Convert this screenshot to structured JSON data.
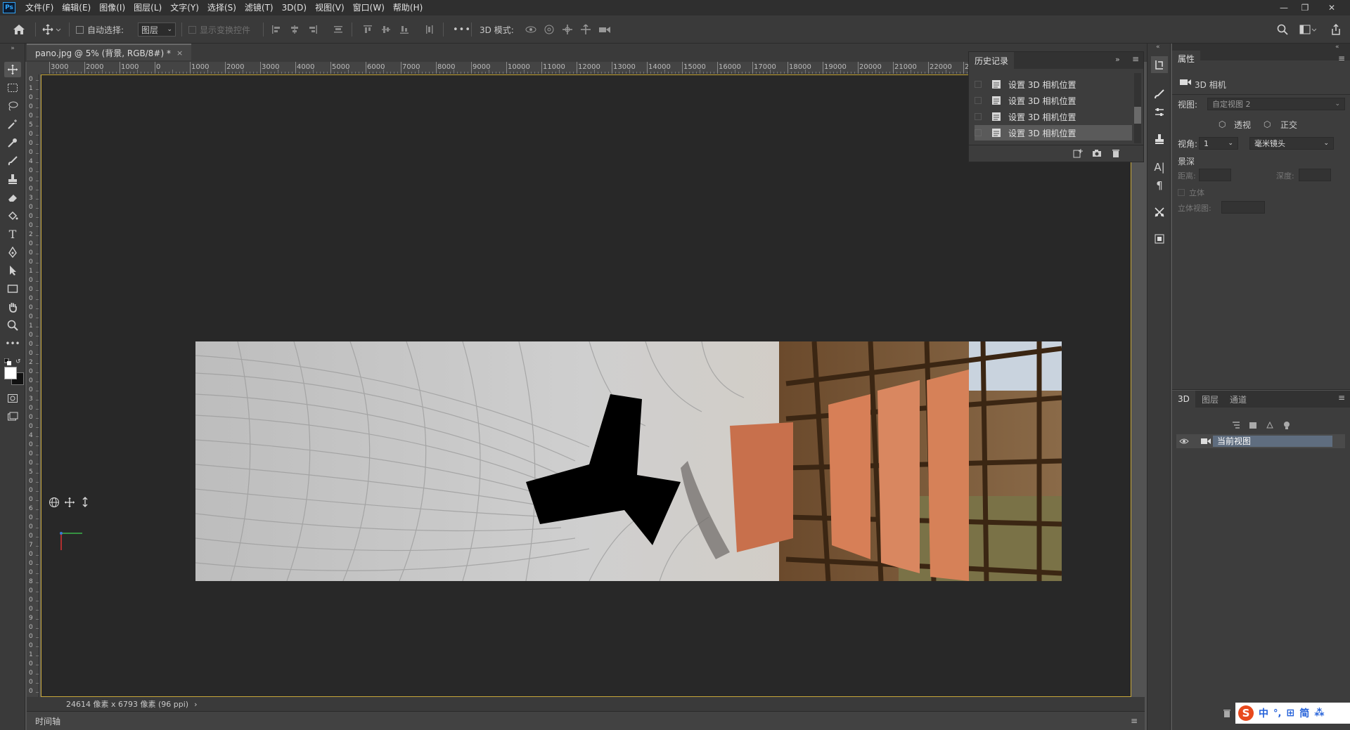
{
  "menubar": {
    "logo": "Ps",
    "items": [
      "文件(F)",
      "编辑(E)",
      "图像(I)",
      "图层(L)",
      "文字(Y)",
      "选择(S)",
      "滤镜(T)",
      "3D(D)",
      "视图(V)",
      "窗口(W)",
      "帮助(H)"
    ]
  },
  "options": {
    "auto_select_label": "自动选择:",
    "auto_select_value": "图层",
    "show_transform_label": "显示变换控件",
    "mode_3d_label": "3D 模式:",
    "more": "•••"
  },
  "document": {
    "tab_title": "pano.jpg @ 5% (背景, RGB/8#) *",
    "ruler_h": [
      "3000",
      "2000",
      "1000",
      "0",
      "1000",
      "2000",
      "3000",
      "4000",
      "5000",
      "6000",
      "7000",
      "8000",
      "9000",
      "10000",
      "11000",
      "12000",
      "13000",
      "14000",
      "15000",
      "16000",
      "17000",
      "18000",
      "19000",
      "20000",
      "21000",
      "22000",
      "2"
    ],
    "ruler_v": [
      "0",
      "1",
      "0",
      "0",
      "0",
      "5",
      "0",
      "0",
      "0",
      "4",
      "0",
      "0",
      "0",
      "3",
      "0",
      "0",
      "0",
      "2",
      "0",
      "0",
      "0",
      "1",
      "0",
      "0",
      "0",
      "0",
      "0",
      "1",
      "0",
      "0",
      "0",
      "2",
      "0",
      "0",
      "0",
      "3",
      "0",
      "0",
      "0",
      "4",
      "0",
      "0",
      "0",
      "5",
      "0",
      "0",
      "0",
      "6",
      "0",
      "0",
      "0",
      "7",
      "0",
      "0",
      "0",
      "8",
      "0",
      "0",
      "0",
      "9",
      "0",
      "0",
      "0",
      "1",
      "0",
      "0",
      "0",
      "0"
    ],
    "status": "24614 像素 x 6793 像素 (96 ppi)",
    "status_arrow": "›",
    "timeline_label": "时间轴"
  },
  "history": {
    "title": "历史记录",
    "items": [
      "设置 3D 相机位置",
      "设置 3D 相机位置",
      "设置 3D 相机位置",
      "设置 3D 相机位置"
    ]
  },
  "properties": {
    "tab": "属性",
    "camera_label": "3D 相机",
    "view_label": "视图:",
    "view_value": "自定视图 2",
    "perspective": "透视",
    "orthographic": "正交",
    "angle_label": "视角:",
    "angle_value": "1",
    "lens_value": "毫米镜头",
    "dof_label": "景深",
    "distance_label": "距离:",
    "depth_label": "深度:",
    "stereo_label": "立体",
    "stereo_view_label": "立体视图:"
  },
  "layers3d": {
    "tabs": [
      "3D",
      "图层",
      "通道"
    ],
    "row_label": "当前视图"
  },
  "ime": {
    "items": [
      "中",
      "°,",
      "⊞",
      "简",
      "⁂"
    ]
  }
}
